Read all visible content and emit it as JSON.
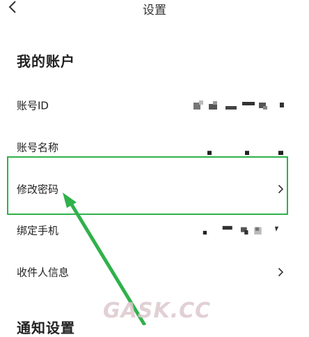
{
  "header": {
    "title": "设置"
  },
  "account_section": {
    "title": "我的账户",
    "rows": [
      {
        "label": "账号ID"
      },
      {
        "label": "账号名称"
      },
      {
        "label": "修改密码"
      },
      {
        "label": "绑定手机"
      },
      {
        "label": "收件人信息"
      }
    ]
  },
  "notification_section": {
    "title": "通知设置"
  },
  "watermark": {
    "text": "GASK.CC"
  },
  "colors": {
    "highlight": "#2fb14b",
    "text": "#222222",
    "chevron": "#333333"
  }
}
